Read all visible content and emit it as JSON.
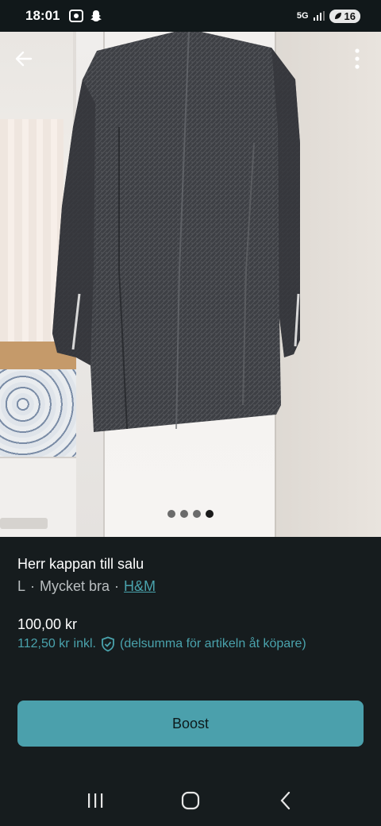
{
  "status_bar": {
    "time": "18:01",
    "network": "5G",
    "battery": "16"
  },
  "photo": {
    "current_index": 4,
    "total": 4,
    "icons": {
      "back": "arrow-left-icon",
      "menu": "more-vert-icon"
    }
  },
  "listing": {
    "title": "Herr kappan till salu",
    "size": "L",
    "separator": "·",
    "condition": "Mycket bra",
    "brand": "H&M",
    "price": "100,00 kr",
    "price_incl": "112,50 kr",
    "incl_label": "inkl.",
    "incl_note": "(delsumma för artikeln åt köpare)"
  },
  "actions": {
    "boost_label": "Boost"
  },
  "colors": {
    "accent": "#4BA0AC",
    "background": "#161C1E",
    "link": "#4AA3AD"
  }
}
